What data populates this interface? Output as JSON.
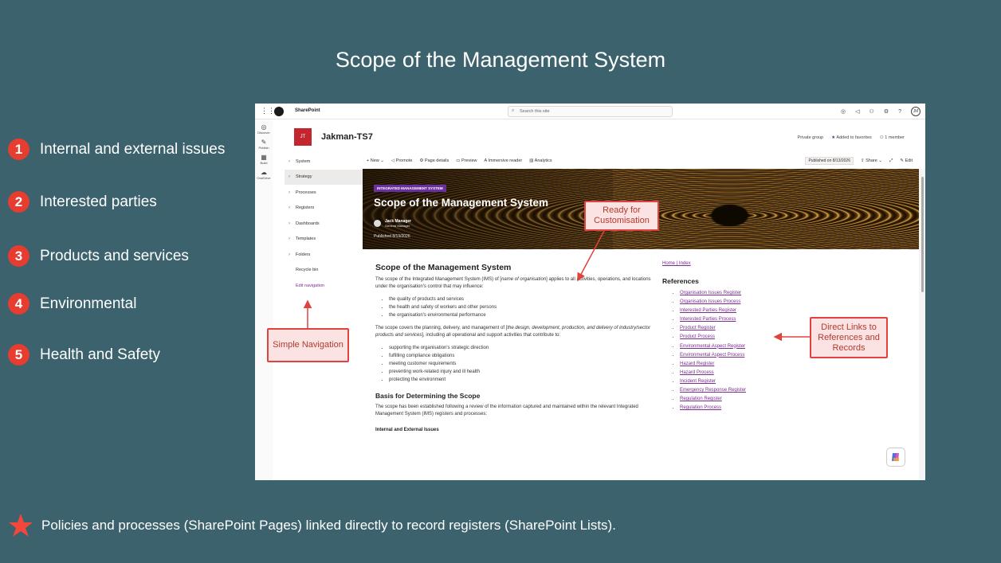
{
  "slide": {
    "title": "Scope of the Management System",
    "features": [
      {
        "num": "1",
        "label": "Internal and external issues"
      },
      {
        "num": "2",
        "label": "Interested parties"
      },
      {
        "num": "3",
        "label": "Products and services"
      },
      {
        "num": "4",
        "label": "Environmental"
      },
      {
        "num": "5",
        "label": "Health and Safety"
      }
    ],
    "footer": "Policies and processes (SharePoint Pages) linked directly to record registers (SharePoint Lists).",
    "accent_color": "#e63d30",
    "background_color": "#3b626d"
  },
  "sharepoint": {
    "app_name": "SharePoint",
    "search_placeholder": "Search this site",
    "avatar_initials": "JM",
    "rail": [
      "Discover",
      "Publish",
      "Build",
      "OneDrive"
    ],
    "site": {
      "tile": "JT",
      "name": "Jakman-TS7",
      "private": "Private group",
      "favorites": "Added to favorites",
      "members": "1 member"
    },
    "nav": {
      "items": [
        "System",
        "Strategy",
        "Processes",
        "Registers",
        "Dashboards",
        "Templates",
        "Folders"
      ],
      "recycle": "Recycle bin",
      "edit": "Edit navigation"
    },
    "commands": {
      "new": "New",
      "promote": "Promote",
      "page_details": "Page details",
      "preview": "Preview",
      "immersive": "Immersive reader",
      "analytics": "Analytics",
      "published": "Published on 8/13/2026",
      "share": "Share",
      "edit": "Edit"
    },
    "hero": {
      "tag": "INTEGRATED MANAGEMENT SYSTEM",
      "title": "Scope of the Management System",
      "author": "Jack Manager",
      "role": "General Manager",
      "published": "Published 8/13/2026"
    },
    "content": {
      "h1": "Scope of the Management System",
      "p1_a": "The scope of the Integrated Management System (IMS) of [",
      "p1_i": "name of organisation",
      "p1_b": "] applies to all activities, operations, and locations under the organisation's control that may influence:",
      "list1": [
        "the quality of products and services",
        "the health and safety of workers and other persons",
        "the organisation's environmental performance"
      ],
      "p2_a": "The scope covers the planning, delivery, and management of [",
      "p2_i": "the design, development, production, and delivery of industry/sector products and services",
      "p2_b": "], including all operational and support activities that contribute to:",
      "list2": [
        "supporting the organisation's strategic direction",
        "fulfilling compliance obligations",
        "meeting customer requirements",
        "preventing work-related injury and ill health",
        "protecting the environment"
      ],
      "h2": "Basis for Determining the Scope",
      "p3": "The scope has been established following a review of the information captured and maintained within the relevant Integrated Management System (IMS) registers and processes:",
      "h3": "Internal and External Issues"
    },
    "links": {
      "home": "Home",
      "sep": " | ",
      "index": "Index"
    },
    "references": {
      "heading": "References",
      "items": [
        "Organisation Issues Register",
        "Organisation Issues Process",
        "Interested Parties Register",
        "Interested Parties Process",
        "Product Register",
        "Product Process",
        "Environmental Aspect Register",
        "Environmental Aspect Process",
        "Hazard Register",
        "Hazard Process",
        "Incident Register",
        "Emergency Response Register",
        "Regulation Register",
        "Regulation Process"
      ]
    }
  },
  "callouts": {
    "customisation": "Ready for Customisation",
    "navigation": "Simple Navigation",
    "links": "Direct Links to References and Records"
  }
}
